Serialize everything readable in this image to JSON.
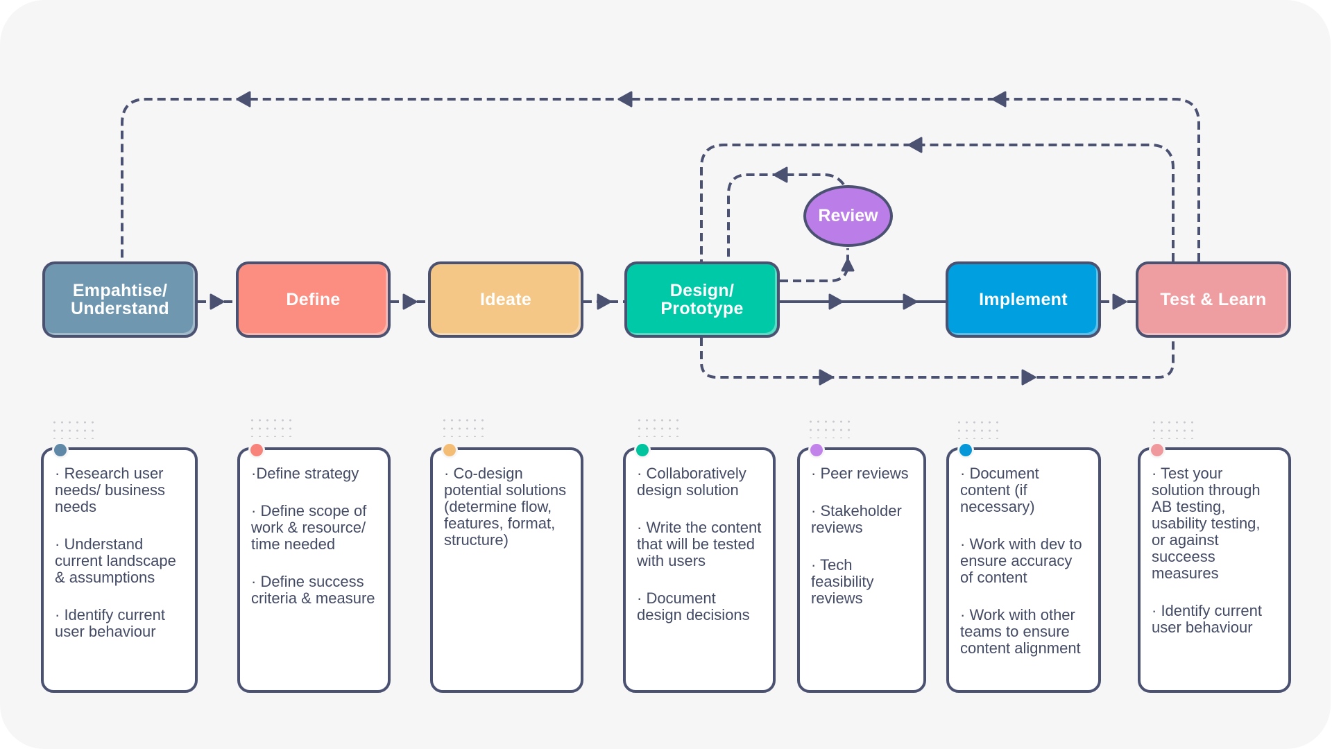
{
  "colors": {
    "line": "#4b5170",
    "background": "#f6f6f7"
  },
  "stages": [
    {
      "id": "empathise",
      "label": "Empahtise/\nUnderstand",
      "color": "#7097b0"
    },
    {
      "id": "define",
      "label": "Define",
      "color": "#fb8e81"
    },
    {
      "id": "ideate",
      "label": "Ideate",
      "color": "#f5c786"
    },
    {
      "id": "design",
      "label": "Design/\nPrototype",
      "color": "#00c9a7"
    },
    {
      "id": "implement",
      "label": "Implement",
      "color": "#009fe0"
    },
    {
      "id": "test",
      "label": "Test & Learn",
      "color": "#ee9da0"
    }
  ],
  "review": {
    "label": "Review",
    "color": "#bb7ee8"
  },
  "cards": [
    {
      "stage": "empathise",
      "dot_color": "#5f88a6",
      "items": [
        "· Research user needs/ business needs",
        "· Understand current landscape & assumptions",
        "· Identify current user behaviour"
      ]
    },
    {
      "stage": "define",
      "dot_color": "#f7837a",
      "items": [
        "·Define strategy",
        "· Define scope of work & resource/ time needed",
        "· Define success criteria & measure"
      ]
    },
    {
      "stage": "ideate",
      "dot_color": "#f4bd76",
      "items": [
        "· Co-design potential solutions (determine flow, features, format, structure)"
      ]
    },
    {
      "stage": "design",
      "dot_color": "#00c49d",
      "items": [
        "· Collaboratively design solution",
        "· Write the content that will be tested with users",
        "· Document design decisions"
      ]
    },
    {
      "stage": "review",
      "dot_color": "#c183ea",
      "items": [
        "· Peer reviews",
        "· Stakeholder reviews",
        "· Tech feasibility reviews"
      ]
    },
    {
      "stage": "implement",
      "dot_color": "#0597d8",
      "items": [
        "· Document content (if necessary)",
        "· Work with dev to ensure accuracy of content",
        "· Work with other teams to ensure content alignment"
      ]
    },
    {
      "stage": "test",
      "dot_color": "#f0999d",
      "items": [
        "· Test your solution through AB testing, usability testing, or against succeess measures",
        "· Identify current user behaviour"
      ]
    }
  ]
}
